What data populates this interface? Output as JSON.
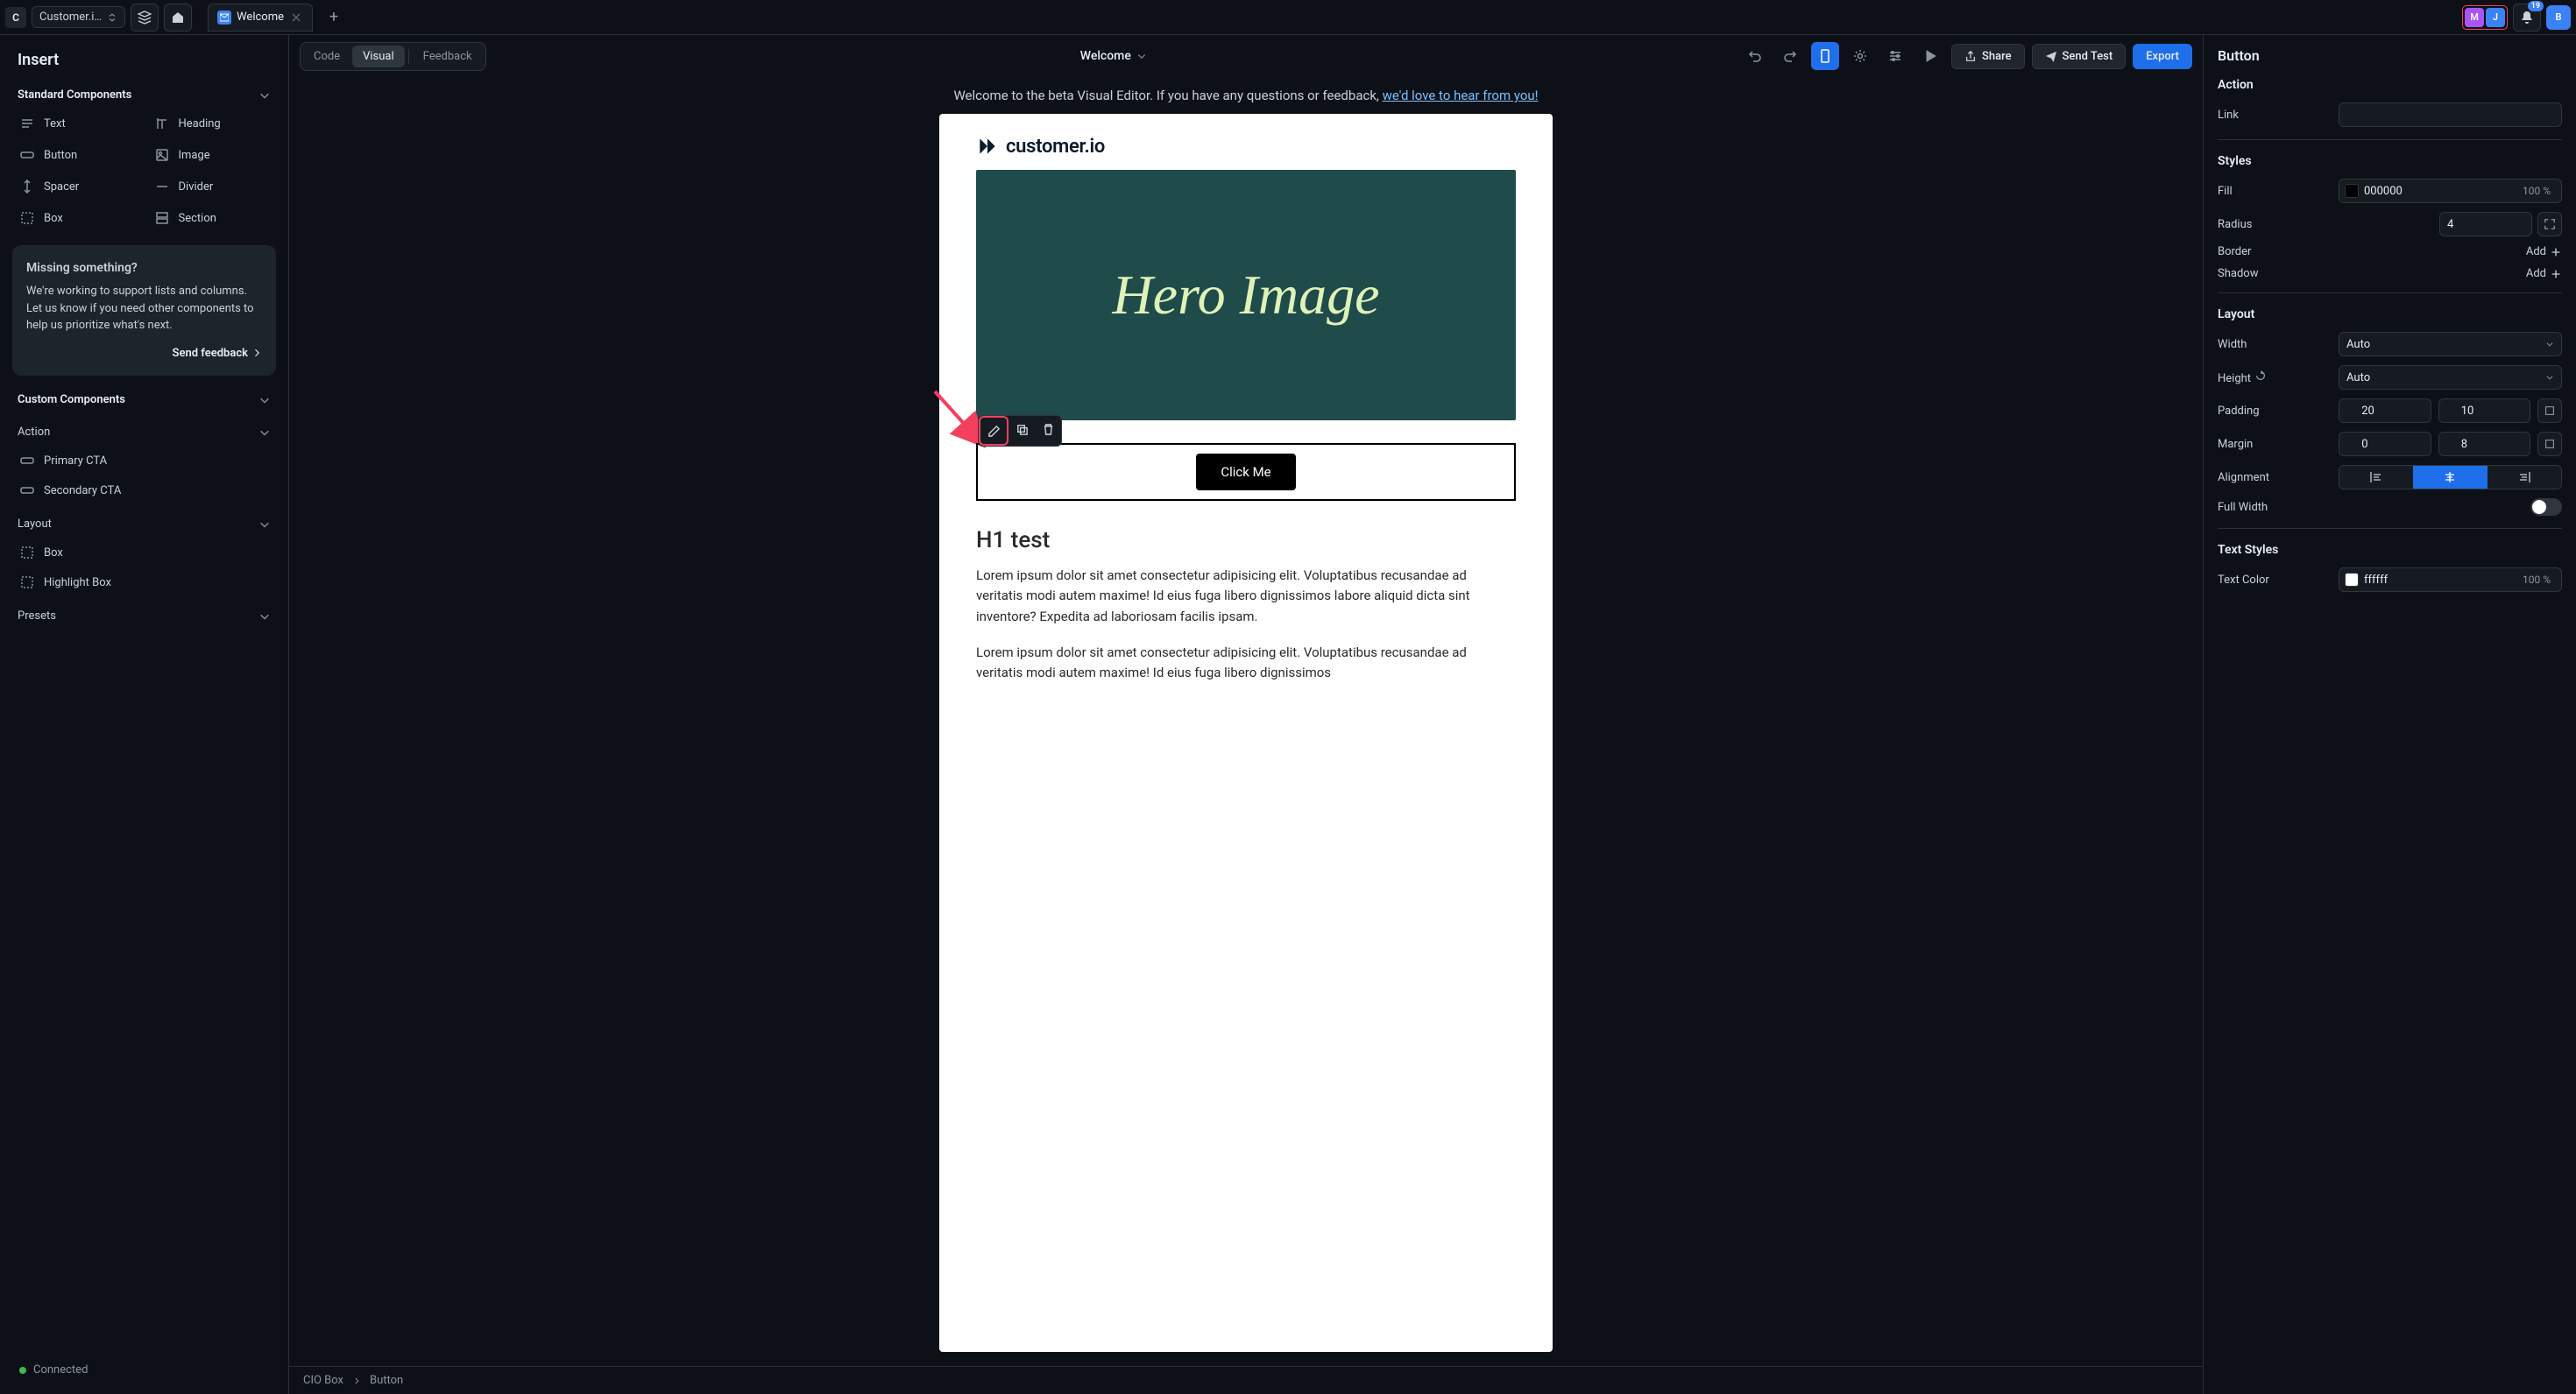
{
  "workspace": {
    "badge": "C",
    "name": "Customer.i…"
  },
  "tab": {
    "label": "Welcome"
  },
  "notifications": "19",
  "avatars": [
    {
      "letter": "M",
      "color": "#a855f7"
    },
    {
      "letter": "J",
      "color": "#3b82f6"
    },
    {
      "letter": "B",
      "color": "#3b82f6"
    }
  ],
  "sidebar": {
    "title": "Insert",
    "groups": {
      "standard": {
        "label": "Standard Components",
        "items": [
          "Text",
          "Heading",
          "Button",
          "Image",
          "Spacer",
          "Divider",
          "Box",
          "Section"
        ]
      },
      "custom": {
        "label": "Custom Components"
      },
      "action": {
        "label": "Action",
        "items": [
          "Primary CTA",
          "Secondary CTA"
        ]
      },
      "layout": {
        "label": "Layout",
        "items": [
          "Box",
          "Highlight Box"
        ]
      },
      "presets": {
        "label": "Presets"
      }
    },
    "info": {
      "title": "Missing something?",
      "body": "We're working to support lists and columns. Let us know if you need other components to help us prioritize what's next.",
      "cta": "Send feedback"
    },
    "status": "Connected"
  },
  "toolbar": {
    "code": "Code",
    "visual": "Visual",
    "feedback": "Feedback",
    "title": "Welcome",
    "share": "Share",
    "sendTest": "Send Test",
    "export": "Export"
  },
  "banner": {
    "text": "Welcome to the beta Visual Editor. If you have any questions or feedback, ",
    "link": "we'd love to hear from you!"
  },
  "canvas": {
    "logoText": "customer.io",
    "heroText": "Hero Image",
    "buttonLabel": "Click Me",
    "h1": "H1 test",
    "para1": "Lorem ipsum dolor sit amet consectetur adipisicing elit. Voluptatibus recusandae ad veritatis modi autem maxime! Id eius fuga libero dignissimos labore aliquid dicta sint inventore? Expedita ad laboriosam facilis ipsam.",
    "para2": "Lorem ipsum dolor sit amet consectetur adipisicing elit. Voluptatibus recusandae ad veritatis modi autem maxime! Id eius fuga libero dignissimos"
  },
  "breadcrumb": {
    "box": "CIO Box",
    "button": "Button"
  },
  "inspector": {
    "title": "Button",
    "action": {
      "heading": "Action",
      "linkLabel": "Link",
      "linkValue": ""
    },
    "styles": {
      "heading": "Styles",
      "fillLabel": "Fill",
      "fillValue": "000000",
      "fillOpacity": "100 %",
      "radiusLabel": "Radius",
      "radiusValue": "4",
      "borderLabel": "Border",
      "shadowLabel": "Shadow",
      "add": "Add"
    },
    "layout": {
      "heading": "Layout",
      "widthLabel": "Width",
      "widthValue": "Auto",
      "heightLabel": "Height",
      "heightValue": "Auto",
      "paddingLabel": "Padding",
      "paddingH": "20",
      "paddingV": "10",
      "marginLabel": "Margin",
      "marginH": "0",
      "marginV": "8",
      "alignmentLabel": "Alignment",
      "fullWidthLabel": "Full Width"
    },
    "textStyles": {
      "heading": "Text Styles",
      "colorLabel": "Text Color",
      "colorValue": "ffffff",
      "colorOpacity": "100 %"
    }
  }
}
